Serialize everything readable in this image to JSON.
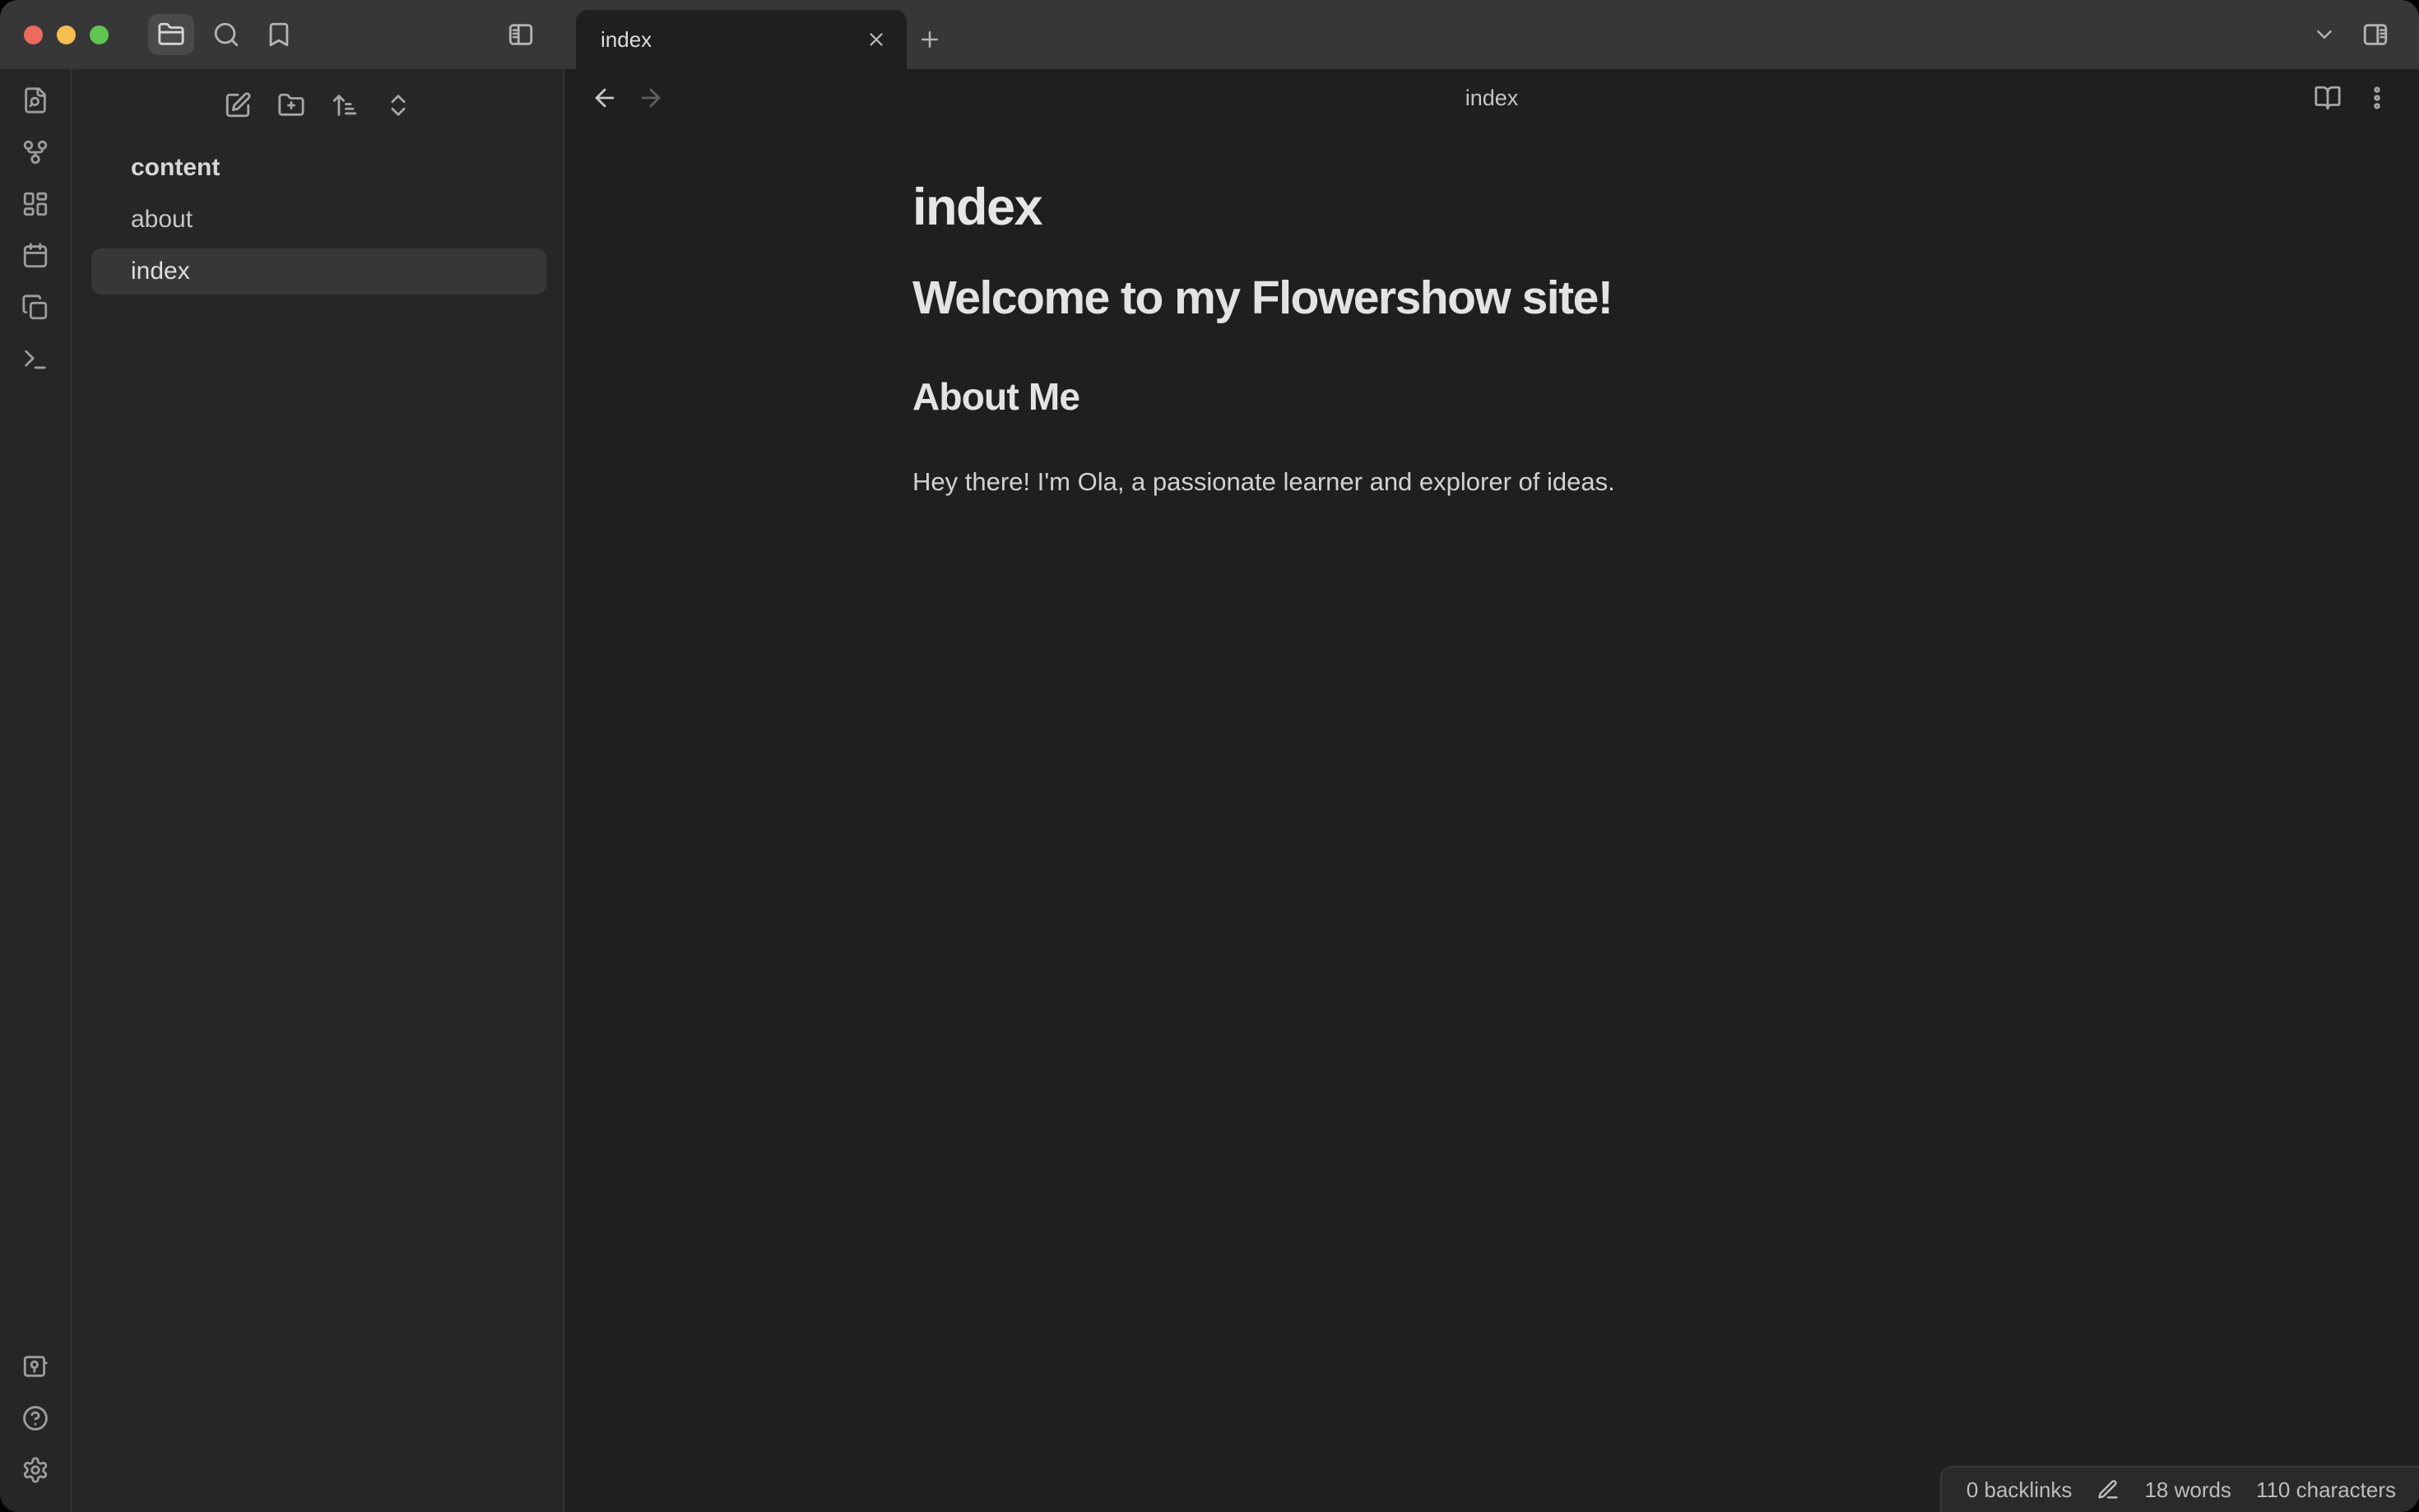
{
  "colors": {
    "titlebar_bg": "#373737",
    "workspace_bg": "#1f1f1f",
    "sidebar_bg": "#262626",
    "selected_item_bg": "#373737",
    "active_button_bg": "#4a4a4a",
    "divider": "#333333",
    "traffic_red": "#ec6a5e",
    "traffic_yellow": "#f5bf4f",
    "traffic_green": "#61c554",
    "text_primary": "#dadada",
    "icon_muted": "#9d9d9d"
  },
  "titlebar": {
    "tab_title": "index",
    "icons": [
      "folder-icon",
      "search-icon",
      "bookmark-icon",
      "panel-left-icon",
      "tab-close-icon",
      "new-tab-icon",
      "chevron-down-icon",
      "panel-right-icon"
    ]
  },
  "ribbon": {
    "top_icons": [
      "file-search-icon",
      "graph-icon",
      "dashboard-icon",
      "calendar-icon",
      "copy-files-icon",
      "terminal-icon"
    ],
    "bottom_icons": [
      "vault-icon",
      "help-icon",
      "settings-icon"
    ]
  },
  "explorer": {
    "header_icons": [
      "new-note-icon",
      "new-folder-icon",
      "sort-icon",
      "collapse-icon"
    ],
    "root_folder": "content",
    "files": [
      {
        "name": "about",
        "selected": false
      },
      {
        "name": "index",
        "selected": true
      }
    ]
  },
  "view": {
    "header_title": "index",
    "header_icons": [
      "arrow-left-icon",
      "arrow-right-icon",
      "book-open-icon",
      "more-options-icon"
    ]
  },
  "document": {
    "inline_title": "index",
    "heading1": "Welcome to my Flowershow site!",
    "heading2": "About Me",
    "paragraph": "Hey there! I'm Ola, a passionate learner and explorer of ideas."
  },
  "status_bar": {
    "backlinks": "0 backlinks",
    "edit_icon": "pencil-icon",
    "words": "18 words",
    "characters": "110 characters"
  }
}
